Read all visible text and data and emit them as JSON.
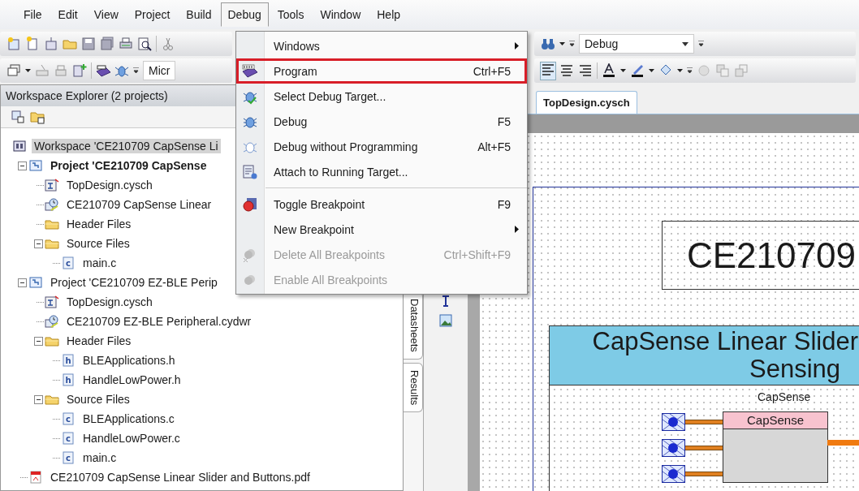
{
  "menu_bar": [
    {
      "label": "File",
      "selected": false
    },
    {
      "label": "Edit",
      "selected": false
    },
    {
      "label": "View",
      "selected": false
    },
    {
      "label": "Project",
      "selected": false
    },
    {
      "label": "Build",
      "selected": false
    },
    {
      "label": "Debug",
      "selected": true
    },
    {
      "label": "Tools",
      "selected": false
    },
    {
      "label": "Window",
      "selected": false
    },
    {
      "label": "Help",
      "selected": false
    }
  ],
  "toolbar": {
    "device_combo": "Micr",
    "configuration_combo": "Debug"
  },
  "debug_menu": {
    "items": [
      {
        "kind": "item",
        "label": "Windows",
        "submenu": true,
        "disabled": false,
        "callout": false
      },
      {
        "kind": "item",
        "label": "Program",
        "shortcut": "Ctrl+F5",
        "submenu": false,
        "disabled": false,
        "callout": true
      },
      {
        "kind": "item",
        "label": "Select Debug Target...",
        "submenu": false,
        "disabled": false,
        "callout": false
      },
      {
        "kind": "item",
        "label": "Debug",
        "shortcut": "F5",
        "submenu": false,
        "disabled": false,
        "callout": false
      },
      {
        "kind": "item",
        "label": "Debug without Programming",
        "shortcut": "Alt+F5",
        "submenu": false,
        "disabled": false,
        "callout": false
      },
      {
        "kind": "item",
        "label": "Attach to Running Target...",
        "submenu": false,
        "disabled": false,
        "callout": false
      },
      {
        "kind": "separator"
      },
      {
        "kind": "item",
        "label": "Toggle Breakpoint",
        "shortcut": "F9",
        "submenu": false,
        "disabled": false,
        "callout": false
      },
      {
        "kind": "item",
        "label": "New Breakpoint",
        "submenu": true,
        "disabled": false,
        "callout": false
      },
      {
        "kind": "item",
        "label": "Delete All Breakpoints",
        "shortcut": "Ctrl+Shift+F9",
        "submenu": false,
        "disabled": true,
        "callout": false
      },
      {
        "kind": "item",
        "label": "Enable All Breakpoints",
        "submenu": false,
        "disabled": true,
        "callout": false
      }
    ]
  },
  "workspace_explorer": {
    "title": "Workspace Explorer (2 projects)",
    "tree": [
      {
        "label": "Workspace 'CE210709 CapSense Li",
        "kind": "workspace",
        "selected": true,
        "children": [
          {
            "label": "Project  'CE210709 CapSense",
            "kind": "project",
            "selected": false,
            "active": true,
            "expanded": true,
            "children": [
              {
                "label": "TopDesign.cysch",
                "kind": "schematic",
                "selected": false
              },
              {
                "label": "CE210709 CapSense Linear",
                "kind": "resources",
                "selected": false
              },
              {
                "label": "Header Files",
                "kind": "folder",
                "selected": false
              },
              {
                "label": "Source Files",
                "kind": "folder",
                "selected": false,
                "expanded": true,
                "children": [
                  {
                    "label": "main.c",
                    "kind": "c",
                    "selected": false
                  }
                ]
              }
            ]
          },
          {
            "label": "Project  'CE210709 EZ-BLE Perip",
            "kind": "project",
            "selected": false,
            "active": false,
            "expanded": true,
            "children": [
              {
                "label": "TopDesign.cysch",
                "kind": "schematic",
                "selected": false
              },
              {
                "label": "CE210709 EZ-BLE Peripheral.cydwr",
                "kind": "resources",
                "selected": false
              },
              {
                "label": "Header Files",
                "kind": "folder",
                "selected": false,
                "expanded": true,
                "children": [
                  {
                    "label": "BLEApplications.h",
                    "kind": "h",
                    "selected": false
                  },
                  {
                    "label": "HandleLowPower.h",
                    "kind": "h",
                    "selected": false
                  }
                ]
              },
              {
                "label": "Source Files",
                "kind": "folder",
                "selected": false,
                "expanded": true,
                "children": [
                  {
                    "label": "BLEApplications.c",
                    "kind": "c",
                    "selected": false
                  },
                  {
                    "label": "HandleLowPower.c",
                    "kind": "c",
                    "selected": false
                  },
                  {
                    "label": "main.c",
                    "kind": "c",
                    "selected": false
                  }
                ]
              }
            ]
          },
          {
            "label": "CE210709 CapSense Linear Slider and Buttons.pdf",
            "kind": "pdf",
            "selected": false
          }
        ]
      }
    ]
  },
  "side_tabs": [
    {
      "label": "Datasheets"
    },
    {
      "label": "Results"
    }
  ],
  "editor": {
    "tabs": [
      {
        "label": "TopDesign.cysch",
        "selected": true
      }
    ],
    "schematic": {
      "title_block": "CE210709",
      "banner_lines": [
        "CapSense Linear Slider",
        "Sensing"
      ],
      "component": {
        "instance_name": "CapSense",
        "type_name": "CapSense"
      }
    }
  }
}
